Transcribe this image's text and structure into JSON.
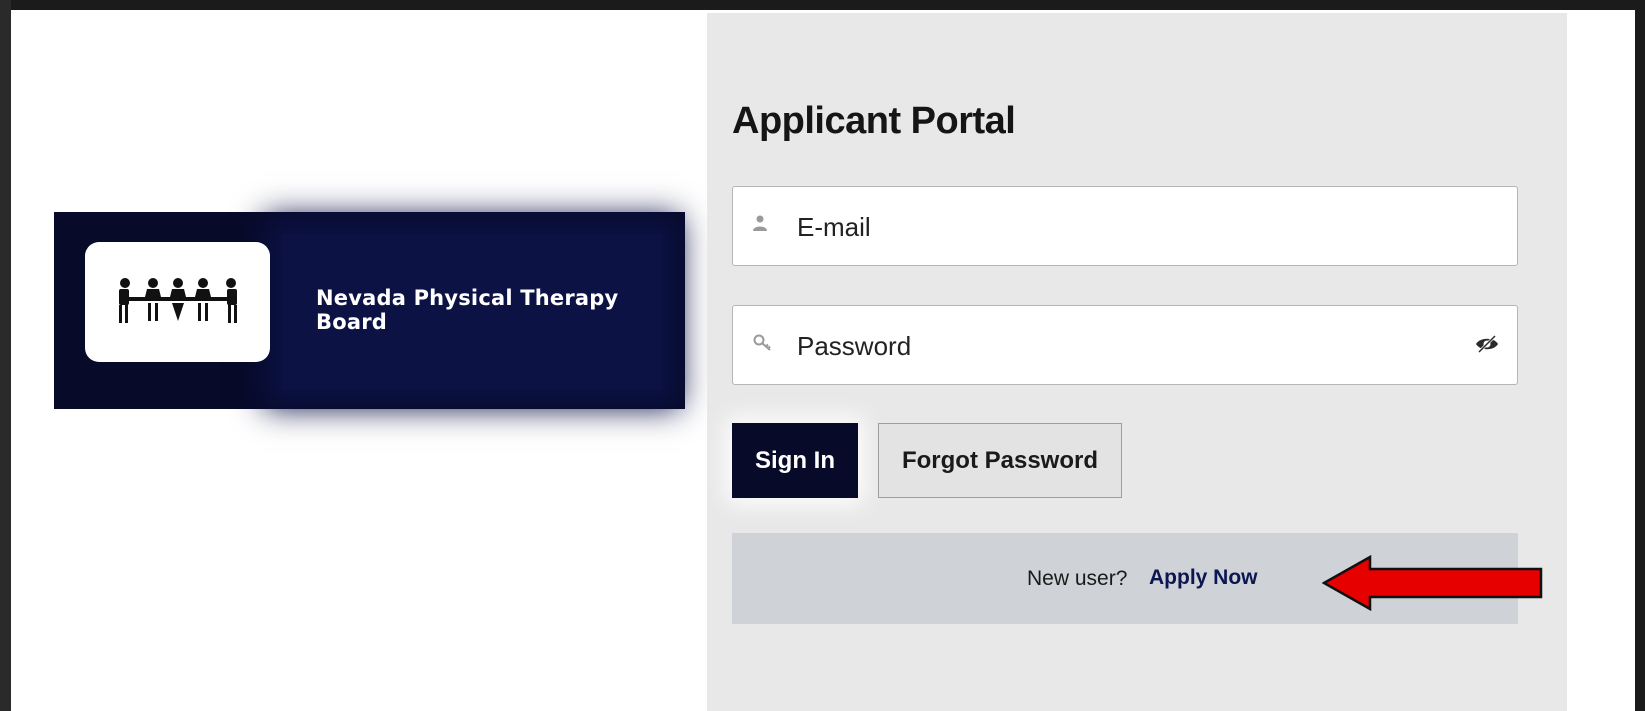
{
  "banner": {
    "org_name": "Nevada Physical Therapy Board",
    "logo_icon": "meeting-people-icon"
  },
  "portal": {
    "title": "Applicant Portal",
    "email": {
      "placeholder": "E-mail",
      "value": "",
      "icon": "user-icon"
    },
    "password": {
      "placeholder": "Password",
      "value": "",
      "icon": "key-icon",
      "toggle_icon": "eye-slash-icon"
    },
    "sign_in_label": "Sign In",
    "forgot_password_label": "Forgot Password",
    "new_user_text": "New user?",
    "apply_now_label": "Apply Now",
    "annotation": "red-arrow-pointing-left"
  },
  "colors": {
    "brand_navy": "#070a28",
    "panel_bg": "#e8e8e8",
    "newuser_bar_bg": "#cfd2d7",
    "annotation_red": "#e60000"
  }
}
